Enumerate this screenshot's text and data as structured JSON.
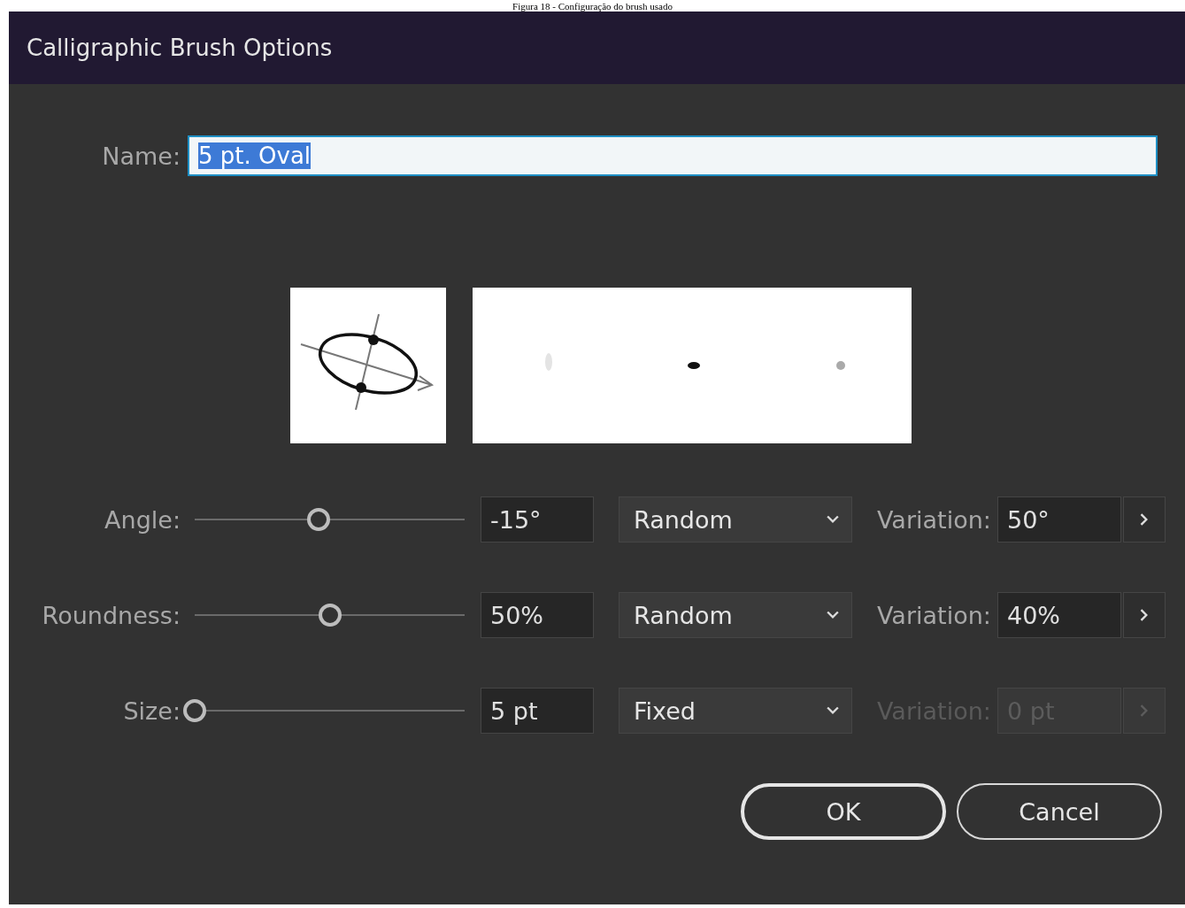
{
  "caption": "Figura 18 - Configuração do brush usado",
  "window": {
    "title": "Calligraphic Brush Options"
  },
  "name_field": {
    "label": "Name:",
    "value": "5 pt. Oval",
    "selected": true
  },
  "rows": [
    {
      "label": "Angle:",
      "level": 0.46,
      "value": "-15°",
      "mode": "Random",
      "variation_label": "Variation:",
      "variation": "50°",
      "disabled": false
    },
    {
      "label": "Roundness:",
      "level": 0.5,
      "value": "50%",
      "mode": "Random",
      "variation_label": "Variation:",
      "variation": "40%",
      "disabled": false
    },
    {
      "label": "Size:",
      "level": 0.0,
      "value": "5 pt",
      "mode": "Fixed",
      "variation_label": "Variation:",
      "variation": "0 pt",
      "disabled": true
    }
  ],
  "buttons": [
    {
      "label": "OK",
      "default": true
    },
    {
      "label": "Cancel",
      "default": false
    }
  ]
}
